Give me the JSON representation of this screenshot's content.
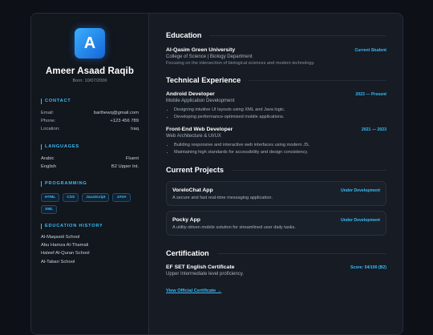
{
  "profile": {
    "initial": "A",
    "name": "Ameer Asaad Raqib",
    "born": "Born: 10/07/2006"
  },
  "contact": {
    "title": "CONTACT",
    "rows": [
      {
        "key": "Email:",
        "value": "barthewq@gmail.com"
      },
      {
        "key": "Phone:",
        "value": "+123 456 789"
      },
      {
        "key": "Location:",
        "value": "Iraq"
      }
    ]
  },
  "languages": {
    "title": "LANGUAGES",
    "rows": [
      {
        "key": "Arabic",
        "value": "Fluent"
      },
      {
        "key": "English",
        "value": "B2 Upper Int."
      }
    ]
  },
  "programming": {
    "title": "PROGRAMMING",
    "tags": [
      "HTML",
      "CSS",
      "JavaScript",
      "JAVA",
      "XML"
    ]
  },
  "education_history": {
    "title": "EDUCATION HISTORY",
    "items": [
      "Al-Maqasid School",
      "Abu Hamza Al-Thamali",
      "Haleef Al-Quran School",
      "Al-Tabari School"
    ]
  },
  "education": {
    "heading": "Education",
    "school": "Al-Qasim Green University",
    "status": "Current Student",
    "department": "College of Science | Biology Department",
    "focus": "Focusing on the intersection of biological sciences and modern technology."
  },
  "experience": {
    "heading": "Technical Experience",
    "jobs": [
      {
        "title": "Android Developer",
        "dates": "2023 — Present",
        "subtitle": "Mobile Application Development",
        "bullets": [
          "Designing intuitive UI layouts using XML and Java logic.",
          "Developing performance-optimized mobile applications."
        ]
      },
      {
        "title": "Front-End Web Developer",
        "dates": "2021 — 2023",
        "subtitle": "Web Architecture & UI/UX",
        "bullets": [
          "Building responsive and interactive web interfaces using modern JS.",
          "Maintaining high standards for accessibility and design consistency."
        ]
      }
    ]
  },
  "projects": {
    "heading": "Current Projects",
    "items": [
      {
        "name": "VoreloChat App",
        "status": "Under Development",
        "desc": "A secure and fast real-time messaging application."
      },
      {
        "name": "Pocky App",
        "status": "Under Development",
        "desc": "A utility-driven mobile solution for streamlined user daily tasks."
      }
    ]
  },
  "certification": {
    "heading": "Certification",
    "name": "EF SET English Certificate",
    "score": "Score: 54/100 (B2)",
    "level": "Upper Intermediate level proficiency.",
    "link_label": "View Official Certificate →"
  },
  "colors": {
    "accent": "#38bdf8",
    "background": "#0d1017",
    "card": "#161b24",
    "sidebar": "#12161d"
  }
}
